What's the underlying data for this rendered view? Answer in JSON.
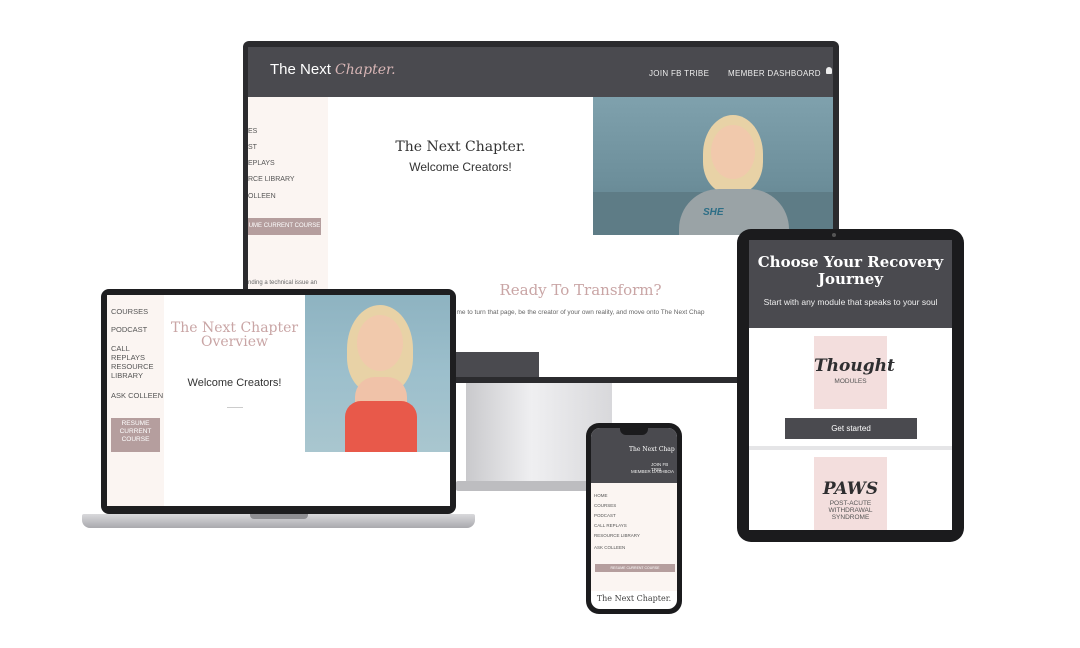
{
  "monitor": {
    "logo_text": "The Next",
    "logo_script": "Chapter.",
    "nav": [
      "JOIN FB TRIBE",
      "MEMBER DASHBOARD"
    ],
    "sidebar_items": [
      "ES",
      "ST",
      "EPLAYS",
      "RCE LIBRARY",
      "OLLEEN"
    ],
    "resume_label": "UME CURRENT COURSE",
    "side_note": "nding a technical issue an",
    "hero_title": "The Next Chapter.",
    "hero_subtitle": "Welcome Creators!",
    "section_title": "Ready To Transform?",
    "section_body": "me to turn that page, be the creator of your own reality, and move onto The Next Chap",
    "shirt_text": "SHE"
  },
  "laptop": {
    "sidebar_items": [
      "COURSES",
      "PODCAST",
      "CALL REPLAYS",
      "RESOURCE LIBRARY",
      "ASK COLLEEN"
    ],
    "resume_label": "RESUME CURRENT COURSE",
    "hero_title": "The Next Chapter Overview",
    "hero_subtitle": "Welcome Creators!"
  },
  "tablet": {
    "title": "Choose Your Recovery Journey",
    "subtitle": "Start with any module that speaks to your soul",
    "card1_title": "Thought",
    "card1_sub": "MODULES",
    "button": "Get started",
    "card2_title": "PAWS",
    "card2_sub": "POST-ACUTE WITHDRAWAL SYNDROME"
  },
  "phone": {
    "logo": "The Next Chap",
    "nav": [
      "JOIN FB TRIB",
      "MEMBER DASHBOA"
    ],
    "menu_items": [
      "HOME",
      "COURSES",
      "PODCAST",
      "CALL REPLAYS",
      "RESOURCE LIBRARY",
      "ASK COLLEEN"
    ],
    "resume_label": "RESUME CURRENT COURSE",
    "footer_title": "The Next Chapter."
  },
  "colors": {
    "nav_dark": "#4a4a4f",
    "accent_rose": "#c9a5a5",
    "button_rose": "#b59e9e",
    "sidebar_bg": "#fbf5f2",
    "card_pink": "#f3dedd"
  }
}
